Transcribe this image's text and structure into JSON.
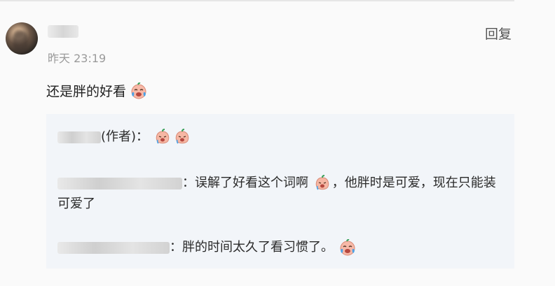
{
  "comment": {
    "author": "ul",
    "timestamp": "昨天 23:19",
    "reply_label": "回复",
    "text": "还是胖的好看",
    "text_emoji": "crying-laughing-emoji"
  },
  "replies": [
    {
      "author": "阿",
      "author_suffix": "(作者)",
      "separator": "：",
      "emojis": [
        "peach-cry-emoji",
        "peach-cry-emoji"
      ]
    },
    {
      "author": "",
      "separator": "：",
      "text_before": "误解了好看这个词啊",
      "emoji": "peach-cry-emoji",
      "text_after": "，他胖时是可爱，现在只能装可爱了"
    },
    {
      "author": "",
      "separator": "：",
      "text": "胖的时间太久了看习惯了。",
      "emoji": "crying-laughing-emoji"
    }
  ],
  "colors": {
    "background": "#fafafa",
    "reply_panel": "#f2f5f9",
    "timestamp": "#9a9a9a"
  }
}
